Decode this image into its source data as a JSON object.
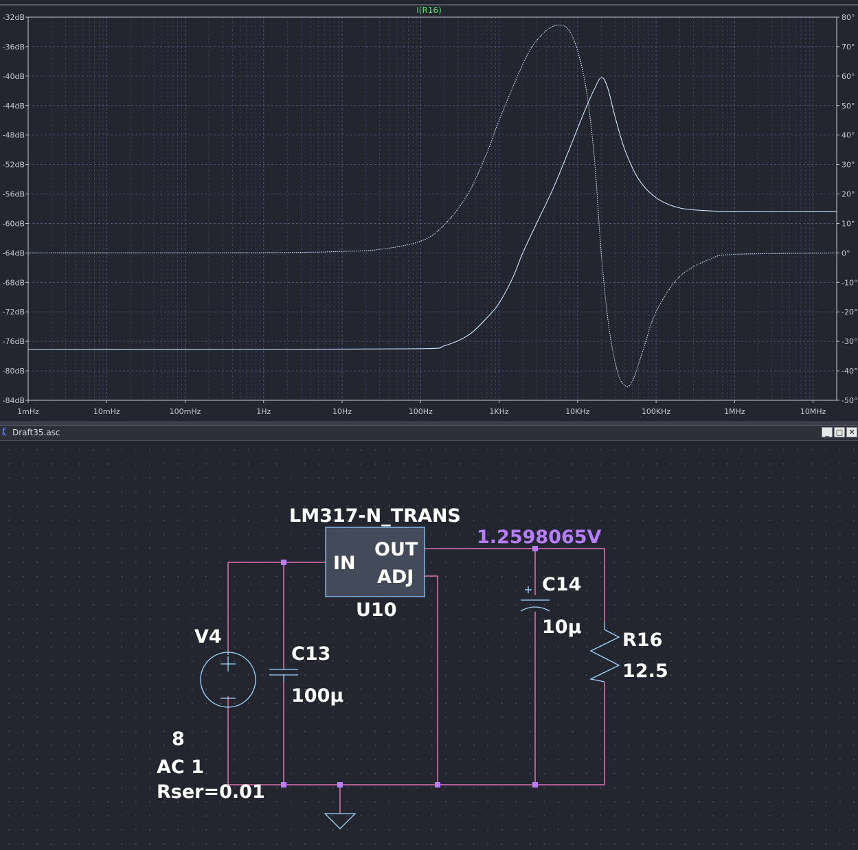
{
  "waveform": {
    "trace_name": "I(R16)",
    "colors": {
      "trace": "#cfe9ff",
      "grid": "#5a5f9a",
      "axis": "#c8c9d0",
      "background": "#23252f",
      "trace_title": "#5fe07f"
    }
  },
  "chart_data": {
    "type": "line",
    "title": "I(R16)",
    "x_scale": "log",
    "xlim_hz": [
      0.001,
      20000000
    ],
    "x_tick_values_hz": [
      0.001,
      0.01,
      0.1,
      1,
      10,
      100,
      1000,
      10000,
      100000,
      1000000,
      10000000
    ],
    "x_tick_labels": [
      "1mHz",
      "10mHz",
      "100mHz",
      "1Hz",
      "10Hz",
      "100Hz",
      "1KHz",
      "10KHz",
      "100KHz",
      "1MHz",
      "10MHz"
    ],
    "left_ylim_db": [
      -84,
      -32
    ],
    "left_tick_values": [
      -32,
      -36,
      -40,
      -44,
      -48,
      -52,
      -56,
      -60,
      -64,
      -68,
      -72,
      -76,
      -80,
      -84
    ],
    "left_tick_labels": [
      "-32dB",
      "-36dB",
      "-40dB",
      "-44dB",
      "-48dB",
      "-52dB",
      "-56dB",
      "-60dB",
      "-64dB",
      "-68dB",
      "-72dB",
      "-76dB",
      "-80dB",
      "-84dB"
    ],
    "right_ylim_deg": [
      -50,
      80
    ],
    "right_tick_values": [
      80,
      70,
      60,
      50,
      40,
      30,
      20,
      10,
      0,
      -10,
      -20,
      -30,
      -40,
      -50
    ],
    "right_tick_labels": [
      "80°",
      "70°",
      "60°",
      "50°",
      "40°",
      "30°",
      "20°",
      "10°",
      "0°",
      "-10°",
      "-20°",
      "-30°",
      "-40°",
      "-50°"
    ],
    "grid": true,
    "series": [
      {
        "axis": "left",
        "style": "solid",
        "points": [
          [
            0.001,
            -77.1
          ],
          [
            1,
            -77.1
          ],
          [
            100,
            -77.0
          ],
          [
            200,
            -76.6
          ],
          [
            400,
            -75.2
          ],
          [
            700,
            -72.8
          ],
          [
            1000,
            -70.8
          ],
          [
            1500,
            -67.3
          ],
          [
            2000,
            -64.0
          ],
          [
            3000,
            -60.0
          ],
          [
            5000,
            -55.0
          ],
          [
            8000,
            -49.7
          ],
          [
            12000,
            -45.0
          ],
          [
            16000,
            -42.0
          ],
          [
            20000,
            -40.2
          ],
          [
            24000,
            -41.5
          ],
          [
            30000,
            -45.5
          ],
          [
            40000,
            -50.0
          ],
          [
            60000,
            -54.0
          ],
          [
            100000,
            -56.5
          ],
          [
            200000,
            -57.9
          ],
          [
            500000,
            -58.3
          ],
          [
            1000000,
            -58.4
          ],
          [
            20000000,
            -58.4
          ]
        ]
      },
      {
        "axis": "right",
        "style": "dotted",
        "points": [
          [
            0.001,
            0
          ],
          [
            1,
            0.1
          ],
          [
            10,
            0.5
          ],
          [
            30,
            1.2
          ],
          [
            100,
            4
          ],
          [
            200,
            9.5
          ],
          [
            400,
            20
          ],
          [
            700,
            34
          ],
          [
            1000,
            45
          ],
          [
            2000,
            64
          ],
          [
            3000,
            72
          ],
          [
            5000,
            77
          ],
          [
            8000,
            75
          ],
          [
            12000,
            60
          ],
          [
            16000,
            35
          ],
          [
            20000,
            0
          ],
          [
            25000,
            -25
          ],
          [
            32000,
            -40
          ],
          [
            40000,
            -45
          ],
          [
            50000,
            -43.5
          ],
          [
            70000,
            -32
          ],
          [
            100000,
            -20
          ],
          [
            200000,
            -8
          ],
          [
            500000,
            -2
          ],
          [
            1000000,
            -0.5
          ],
          [
            20000000,
            0
          ]
        ]
      }
    ]
  },
  "window": {
    "title": "Draft35.asc",
    "buttons": {
      "minimize": "_",
      "restore": "□",
      "close": "✕"
    }
  },
  "schematic": {
    "regulator": {
      "model": "LM317-N_TRANS",
      "ref": "U10",
      "pin_in": "IN",
      "pin_out": "OUT",
      "pin_adj": "ADJ"
    },
    "node_voltage": "1.2598065V",
    "source": {
      "ref": "V4",
      "dc": "8",
      "ac": "AC 1",
      "rser": "Rser=0.01"
    },
    "c13": {
      "ref": "C13",
      "value": "100µ"
    },
    "c14": {
      "ref": "C14",
      "value": "10µ"
    },
    "r16": {
      "ref": "R16",
      "value": "12.5"
    },
    "colors": {
      "wire": "#ff80c8",
      "junction": "#b77cff",
      "component": "#9fd8ff",
      "ic_fill": "#434a5a",
      "ic_border": "#8ec8ff",
      "voltage": "#b77cff"
    }
  }
}
